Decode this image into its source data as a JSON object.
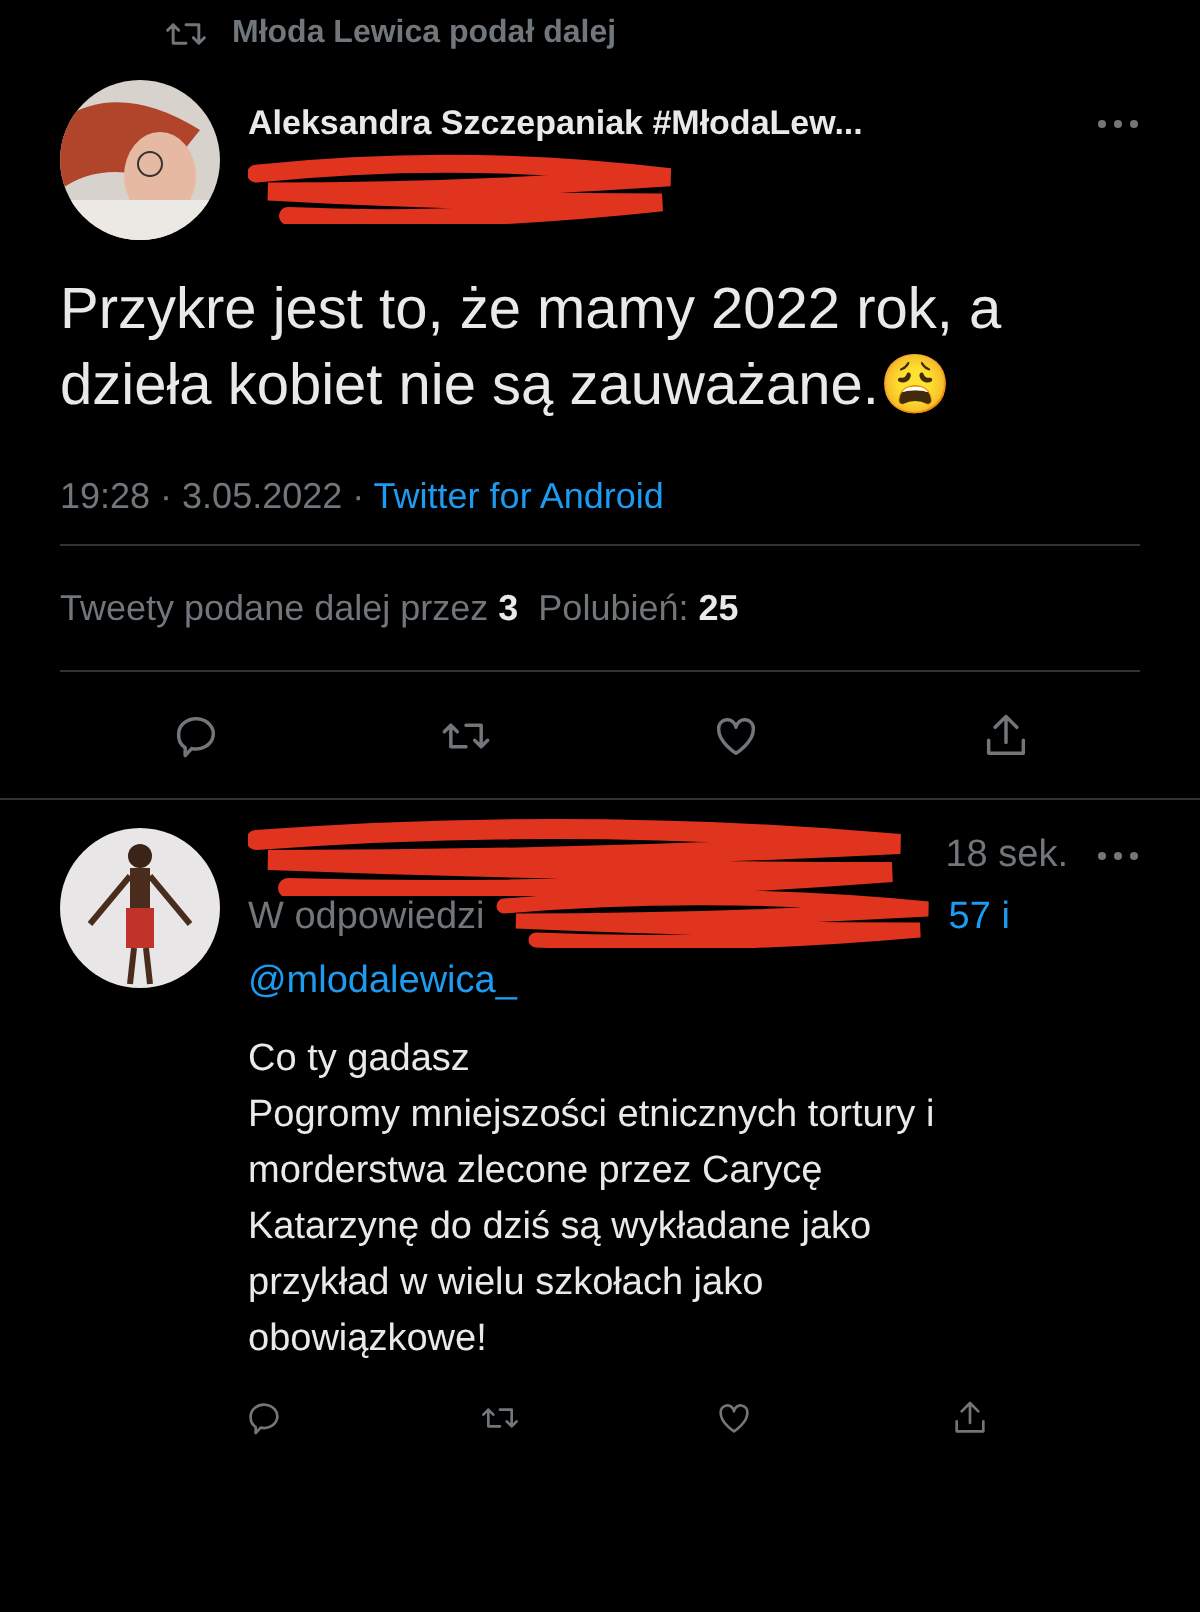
{
  "retweet_header": {
    "text": "Młoda Lewica podał dalej"
  },
  "tweet": {
    "author": "Aleksandra Szczepaniak #MłodaLew...",
    "handle_redacted": true,
    "text": "Przykre jest to, że mamy 2022 rok, a dzieła kobiet nie są zauważane.😩",
    "time": "19:28 · 3.05.2022 · ",
    "source": "Twitter for Android",
    "retweets_label": "Tweety podane dalej przez ",
    "retweets": "3",
    "likes_label": "Polubień: ",
    "likes": "25"
  },
  "reply": {
    "name_redacted": true,
    "time": "18 sek.",
    "reply_prefix": "W odpowiedzi",
    "reply_suffix": "57 i",
    "mention": "@mlodalewica_",
    "body": [
      "Co ty gadasz",
      "Pogromy mniejszości etnicznych tortury i",
      "morderstwa zlecone przez Carycę",
      "Katarzynę do dziś są wykładane jako",
      "przykład w wielu szkołach jako",
      "obowiązkowe!"
    ]
  }
}
